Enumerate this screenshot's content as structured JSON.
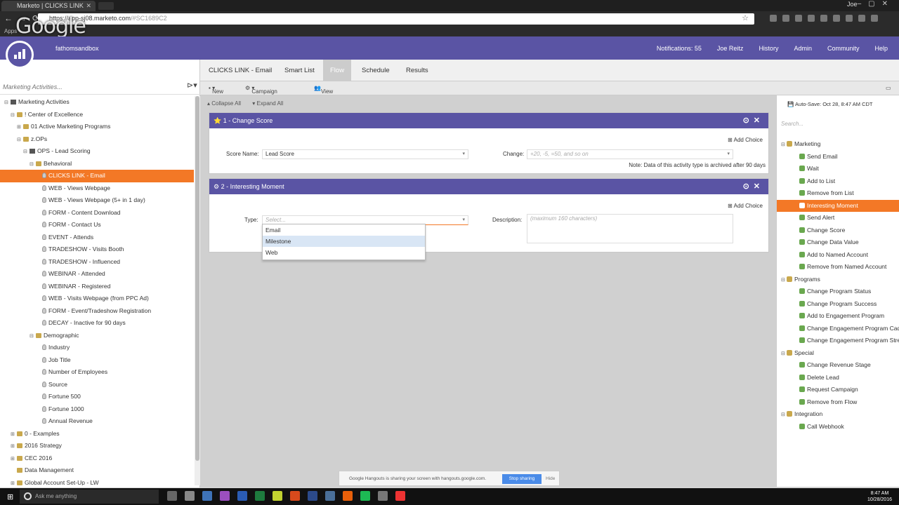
{
  "browser": {
    "tab_title": "Marketo | CLICKS LINK",
    "url_prefix": "https://",
    "url_host": "app-sj08.marketo.com",
    "url_path": "/#SC1689C2",
    "bookmarks_label": "Apps",
    "window_user": "Joe",
    "overlay_logo": "Google"
  },
  "header": {
    "workspace": "fathomsandbox",
    "nav": [
      "Notifications: 55",
      "Joe Reitz",
      "History",
      "Admin",
      "Community",
      "Help"
    ]
  },
  "left": {
    "search_placeholder": "Marketing Activities...",
    "tree": [
      {
        "label": "Marketing Activities",
        "indent": 0,
        "kind": "root",
        "toggle": "⊟"
      },
      {
        "label": "! Center of Excellence",
        "indent": 1,
        "kind": "folder",
        "toggle": "⊟"
      },
      {
        "label": "01 Active Marketing Programs",
        "indent": 2,
        "kind": "folder",
        "toggle": "⊞"
      },
      {
        "label": "z.OPs",
        "indent": 2,
        "kind": "folder",
        "toggle": "⊟"
      },
      {
        "label": "OPS - Lead Scoring",
        "indent": 3,
        "kind": "prog",
        "toggle": "⊟"
      },
      {
        "label": "Behavioral",
        "indent": 4,
        "kind": "folder",
        "toggle": "⊟"
      },
      {
        "label": "CLICKS LINK - Email",
        "indent": 5,
        "kind": "bulb",
        "toggle": "",
        "selected": true
      },
      {
        "label": "WEB - Views Webpage",
        "indent": 5,
        "kind": "bulb",
        "toggle": ""
      },
      {
        "label": "WEB - Views Webpage (5+ in 1 day)",
        "indent": 5,
        "kind": "bulb",
        "toggle": ""
      },
      {
        "label": "FORM - Content Download",
        "indent": 5,
        "kind": "bulb",
        "toggle": ""
      },
      {
        "label": "FORM - Contact Us",
        "indent": 5,
        "kind": "bulb",
        "toggle": ""
      },
      {
        "label": "EVENT - Attends",
        "indent": 5,
        "kind": "bulb",
        "toggle": ""
      },
      {
        "label": "TRADESHOW - Visits Booth",
        "indent": 5,
        "kind": "bulb",
        "toggle": ""
      },
      {
        "label": "TRADESHOW - Influenced",
        "indent": 5,
        "kind": "bulb",
        "toggle": ""
      },
      {
        "label": "WEBINAR - Attended",
        "indent": 5,
        "kind": "bulb",
        "toggle": ""
      },
      {
        "label": "WEBINAR - Registered",
        "indent": 5,
        "kind": "bulb",
        "toggle": ""
      },
      {
        "label": "WEB - Visits Webpage (from PPC Ad)",
        "indent": 5,
        "kind": "bulb",
        "toggle": ""
      },
      {
        "label": "FORM - Event/Tradeshow Registration",
        "indent": 5,
        "kind": "bulb",
        "toggle": ""
      },
      {
        "label": "DECAY - Inactive for 90 days",
        "indent": 5,
        "kind": "bulb",
        "toggle": ""
      },
      {
        "label": "Demographic",
        "indent": 4,
        "kind": "folder",
        "toggle": "⊟"
      },
      {
        "label": "Industry",
        "indent": 5,
        "kind": "bulb",
        "toggle": ""
      },
      {
        "label": "Job Title",
        "indent": 5,
        "kind": "bulb",
        "toggle": ""
      },
      {
        "label": "Number of Employees",
        "indent": 5,
        "kind": "bulb",
        "toggle": ""
      },
      {
        "label": "Source",
        "indent": 5,
        "kind": "bulb",
        "toggle": ""
      },
      {
        "label": "Fortune 500",
        "indent": 5,
        "kind": "bulb",
        "toggle": ""
      },
      {
        "label": "Fortune 1000",
        "indent": 5,
        "kind": "bulb",
        "toggle": ""
      },
      {
        "label": "Annual Revenue",
        "indent": 5,
        "kind": "bulb",
        "toggle": ""
      },
      {
        "label": "0 - Examples",
        "indent": 1,
        "kind": "folder",
        "toggle": "⊞"
      },
      {
        "label": "2016 Strategy",
        "indent": 1,
        "kind": "folder",
        "toggle": "⊞"
      },
      {
        "label": "CEC 2016",
        "indent": 1,
        "kind": "folder",
        "toggle": "⊞"
      },
      {
        "label": "Data Management",
        "indent": 1,
        "kind": "folder",
        "toggle": ""
      },
      {
        "label": "Global Account Set-Up - LW",
        "indent": 1,
        "kind": "folder",
        "toggle": "⊞"
      }
    ]
  },
  "tabs": [
    "CLICKS LINK - Email",
    "Smart List",
    "Flow",
    "Schedule",
    "Results"
  ],
  "active_tab": "Flow",
  "toolbar": {
    "new": "New",
    "campaign_actions": "Campaign Actions",
    "view_members": "View Campaign Members"
  },
  "canvas": {
    "collapse_all": "Collapse All",
    "expand_all": "Expand All",
    "step1": {
      "title": "1 - Change Score",
      "add_choice": "Add Choice",
      "score_name_label": "Score Name:",
      "score_name_value": "Lead Score",
      "change_label": "Change:",
      "change_placeholder": "+20, -5, =50, and so on",
      "note": "Note: Data of this activity type is archived after 90 days"
    },
    "step2": {
      "title": "2 - Interesting Moment",
      "add_choice": "Add Choice",
      "type_label": "Type:",
      "type_placeholder": "Select...",
      "description_label": "Description:",
      "description_placeholder": "(maximum 160 characters)",
      "options": [
        "Email",
        "Milestone",
        "Web"
      ],
      "highlighted_option": "Milestone"
    }
  },
  "right": {
    "autosave": "Auto-Save: Oct 28, 8:47 AM CDT",
    "search_placeholder": "Search...",
    "palette": [
      {
        "label": "Marketing",
        "cat": true
      },
      {
        "label": "Send Email"
      },
      {
        "label": "Wait"
      },
      {
        "label": "Add to List"
      },
      {
        "label": "Remove from List"
      },
      {
        "label": "Interesting Moment",
        "selected": true
      },
      {
        "label": "Send Alert"
      },
      {
        "label": "Change Score"
      },
      {
        "label": "Change Data Value"
      },
      {
        "label": "Add to Named Account"
      },
      {
        "label": "Remove from Named Account"
      },
      {
        "label": "Programs",
        "cat": true
      },
      {
        "label": "Change Program Status"
      },
      {
        "label": "Change Program Success"
      },
      {
        "label": "Add to Engagement Program"
      },
      {
        "label": "Change Engagement Program Cadence"
      },
      {
        "label": "Change Engagement Program Stream"
      },
      {
        "label": "Special",
        "cat": true
      },
      {
        "label": "Change Revenue Stage"
      },
      {
        "label": "Delete Lead"
      },
      {
        "label": "Request Campaign"
      },
      {
        "label": "Remove from Flow"
      },
      {
        "label": "Integration",
        "cat": true
      },
      {
        "label": "Call Webhook"
      }
    ]
  },
  "hangouts": {
    "message": "Google Hangouts is sharing your screen with hangouts.google.com.",
    "stop": "Stop sharing",
    "hide": "Hide"
  },
  "taskbar": {
    "search_placeholder": "Ask me anything",
    "time": "8:47 AM",
    "date": "10/28/2016",
    "app_colors": [
      "#666",
      "#888",
      "#3e73b8",
      "#9b4fbf",
      "#2b5cb3",
      "#1e7b3e",
      "#c2d230",
      "#d84a1c",
      "#2c4a8a",
      "#4a6f98",
      "#e8600a",
      "#1db954",
      "#777",
      "#e33"
    ]
  },
  "colors": {
    "brand": "#5a54a4",
    "selection": "#f37826"
  }
}
